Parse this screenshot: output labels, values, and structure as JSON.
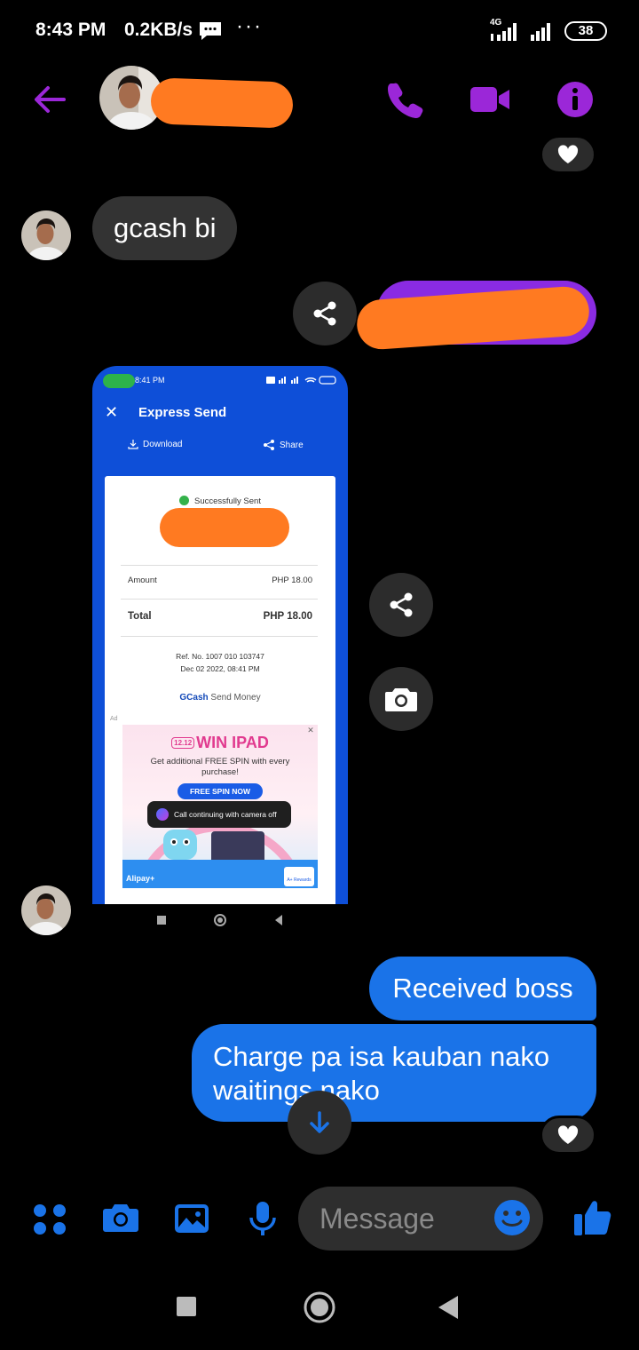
{
  "status_bar": {
    "time": "8:43 PM",
    "speed": "0.2KB/s",
    "dots": "···",
    "network": "4G",
    "battery": "38"
  },
  "header": {
    "back_icon": "arrow-left-icon",
    "call_icon": "phone-icon",
    "video_icon": "video-icon",
    "info_icon": "info-icon",
    "accent_color": "#9b27d8"
  },
  "messages": {
    "incoming_1": "gcash bi",
    "outgoing_1": "Received boss",
    "outgoing_2": "Charge pa isa kauban nako waitings nako",
    "reaction": "heart"
  },
  "receipt_screenshot": {
    "time": "8:41 PM",
    "title": "Express Send",
    "download_label": "Download",
    "share_label": "Share",
    "status": "Successfully Sent",
    "amount_label": "Amount",
    "amount_value": "PHP 18.00",
    "total_label": "Total",
    "total_value": "PHP 18.00",
    "ref_no": "Ref. No. 1007 010 103747",
    "date": "Dec 02 2022, 08:41 PM",
    "brand": "GCash",
    "brand_suffix": "Send Money",
    "ad_label": "Ad",
    "ad_title": "WIN IPAD",
    "ad_badge": "12.12",
    "ad_subtitle": "Get additional FREE SPIN with every purchase!",
    "ad_button": "FREE SPIN NOW",
    "ad_brand": "Alipay+",
    "ad_rewards": "A+ Rewards",
    "toast": "Call continuing with camera off"
  },
  "composer": {
    "placeholder": "Message",
    "accent_color": "#1a73e8"
  }
}
